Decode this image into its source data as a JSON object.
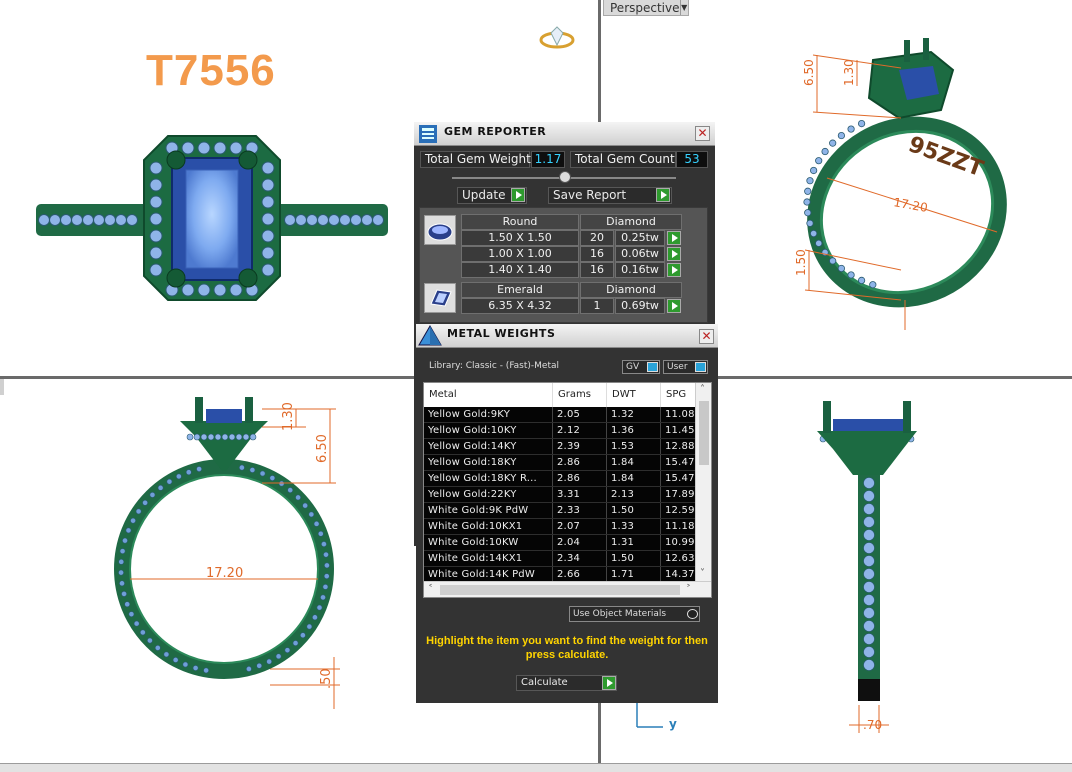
{
  "sku": "T7556",
  "viewport_tab": {
    "label": "Perspective"
  },
  "axis_label": "y",
  "dimensions": {
    "tr_height": "6.50",
    "tr_top": "1.30",
    "tr_diameter": "17.20",
    "tr_band": "1.50",
    "bl_top": "1.30",
    "bl_height": "6.50",
    "bl_diameter": "17.20",
    "bl_band": ".50",
    "br_width": ".70"
  },
  "gem_reporter": {
    "title": "GEM REPORTER",
    "total_weight_label": "Total Gem Weight",
    "total_weight_value": "1.17",
    "total_count_label": "Total Gem Count",
    "total_count_value": "53",
    "update_label": "Update",
    "save_label": "Save Report",
    "groups": [
      {
        "shape": "Round",
        "material": "Diamond",
        "rows": [
          {
            "size": "1.50 X 1.50",
            "count": "20",
            "weight": "0.25tw"
          },
          {
            "size": "1.00 X 1.00",
            "count": "16",
            "weight": "0.06tw"
          },
          {
            "size": "1.40 X 1.40",
            "count": "16",
            "weight": "0.16tw"
          }
        ]
      },
      {
        "shape": "Emerald",
        "material": "Diamond",
        "rows": [
          {
            "size": "6.35 X 4.32",
            "count": "1",
            "weight": "0.69tw"
          }
        ]
      }
    ]
  },
  "metal_weights": {
    "title": "METAL WEIGHTS",
    "library": "Library: Classic - (Fast)-Metal",
    "toggle_gv": "GV",
    "toggle_user": "User",
    "columns": [
      "Metal",
      "Grams",
      "DWT",
      "SPG"
    ],
    "rows": [
      [
        "Yellow Gold:9KY",
        "2.05",
        "1.32",
        "11.08"
      ],
      [
        "Yellow Gold:10KY",
        "2.12",
        "1.36",
        "11.45"
      ],
      [
        "Yellow Gold:14KY",
        "2.39",
        "1.53",
        "12.88"
      ],
      [
        "Yellow Gold:18KY",
        "2.86",
        "1.84",
        "15.47"
      ],
      [
        "Yellow Gold:18KY R...",
        "2.86",
        "1.84",
        "15.47"
      ],
      [
        "Yellow Gold:22KY",
        "3.31",
        "2.13",
        "17.89"
      ],
      [
        "White Gold:9K PdW",
        "2.33",
        "1.50",
        "12.59"
      ],
      [
        "White Gold:10KX1",
        "2.07",
        "1.33",
        "11.18"
      ],
      [
        "White Gold:10KW",
        "2.04",
        "1.31",
        "10.99"
      ],
      [
        "White Gold:14KX1",
        "2.34",
        "1.50",
        "12.63"
      ],
      [
        "White Gold:14K PdW",
        "2.66",
        "1.71",
        "14.37"
      ]
    ],
    "use_object_materials": "Use Object Materials",
    "hint": "Highlight the item you want to find the weight for then press calculate.",
    "calculate_label": "Calculate"
  }
}
